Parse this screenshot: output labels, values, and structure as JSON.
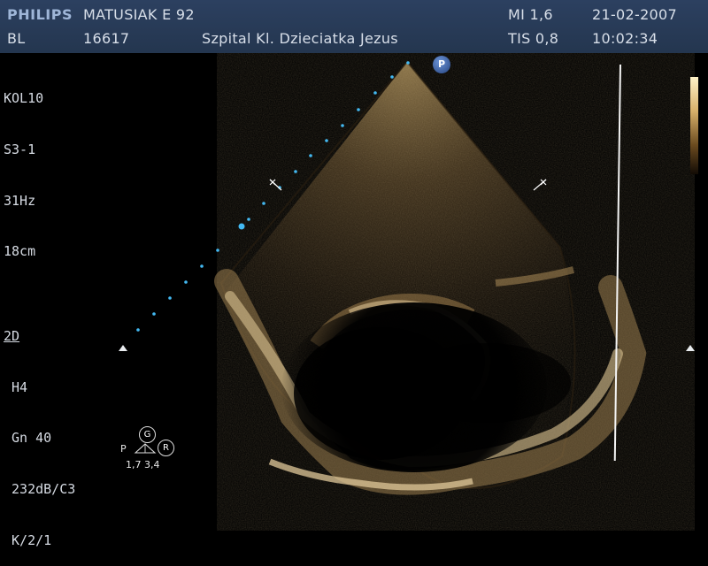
{
  "header": {
    "brand": "PHILIPS",
    "patient": "MATUSIAK E 92",
    "mi": "MI 1,6",
    "date": "21-02-2007",
    "bl": "BL",
    "study_id": "16617",
    "hospital": "Szpital Kl. Dzieciatka Jezus",
    "tis": "TIS 0,8",
    "time": "10:02:34"
  },
  "params": [
    "KOL10",
    "S3-1",
    "31Hz",
    "18cm",
    "",
    "2D",
    " H4",
    " Gn 40",
    " 232dB/C3",
    " K/2/1"
  ],
  "probe_marker": "P",
  "diagram": {
    "left": "P",
    "top": "G",
    "right": "R",
    "values": "1,7 3,4"
  },
  "colors": {
    "header": "#2c4060",
    "text": "#d6dbe3",
    "brand": "#9fb6d8",
    "dots": "#43b9f2"
  }
}
